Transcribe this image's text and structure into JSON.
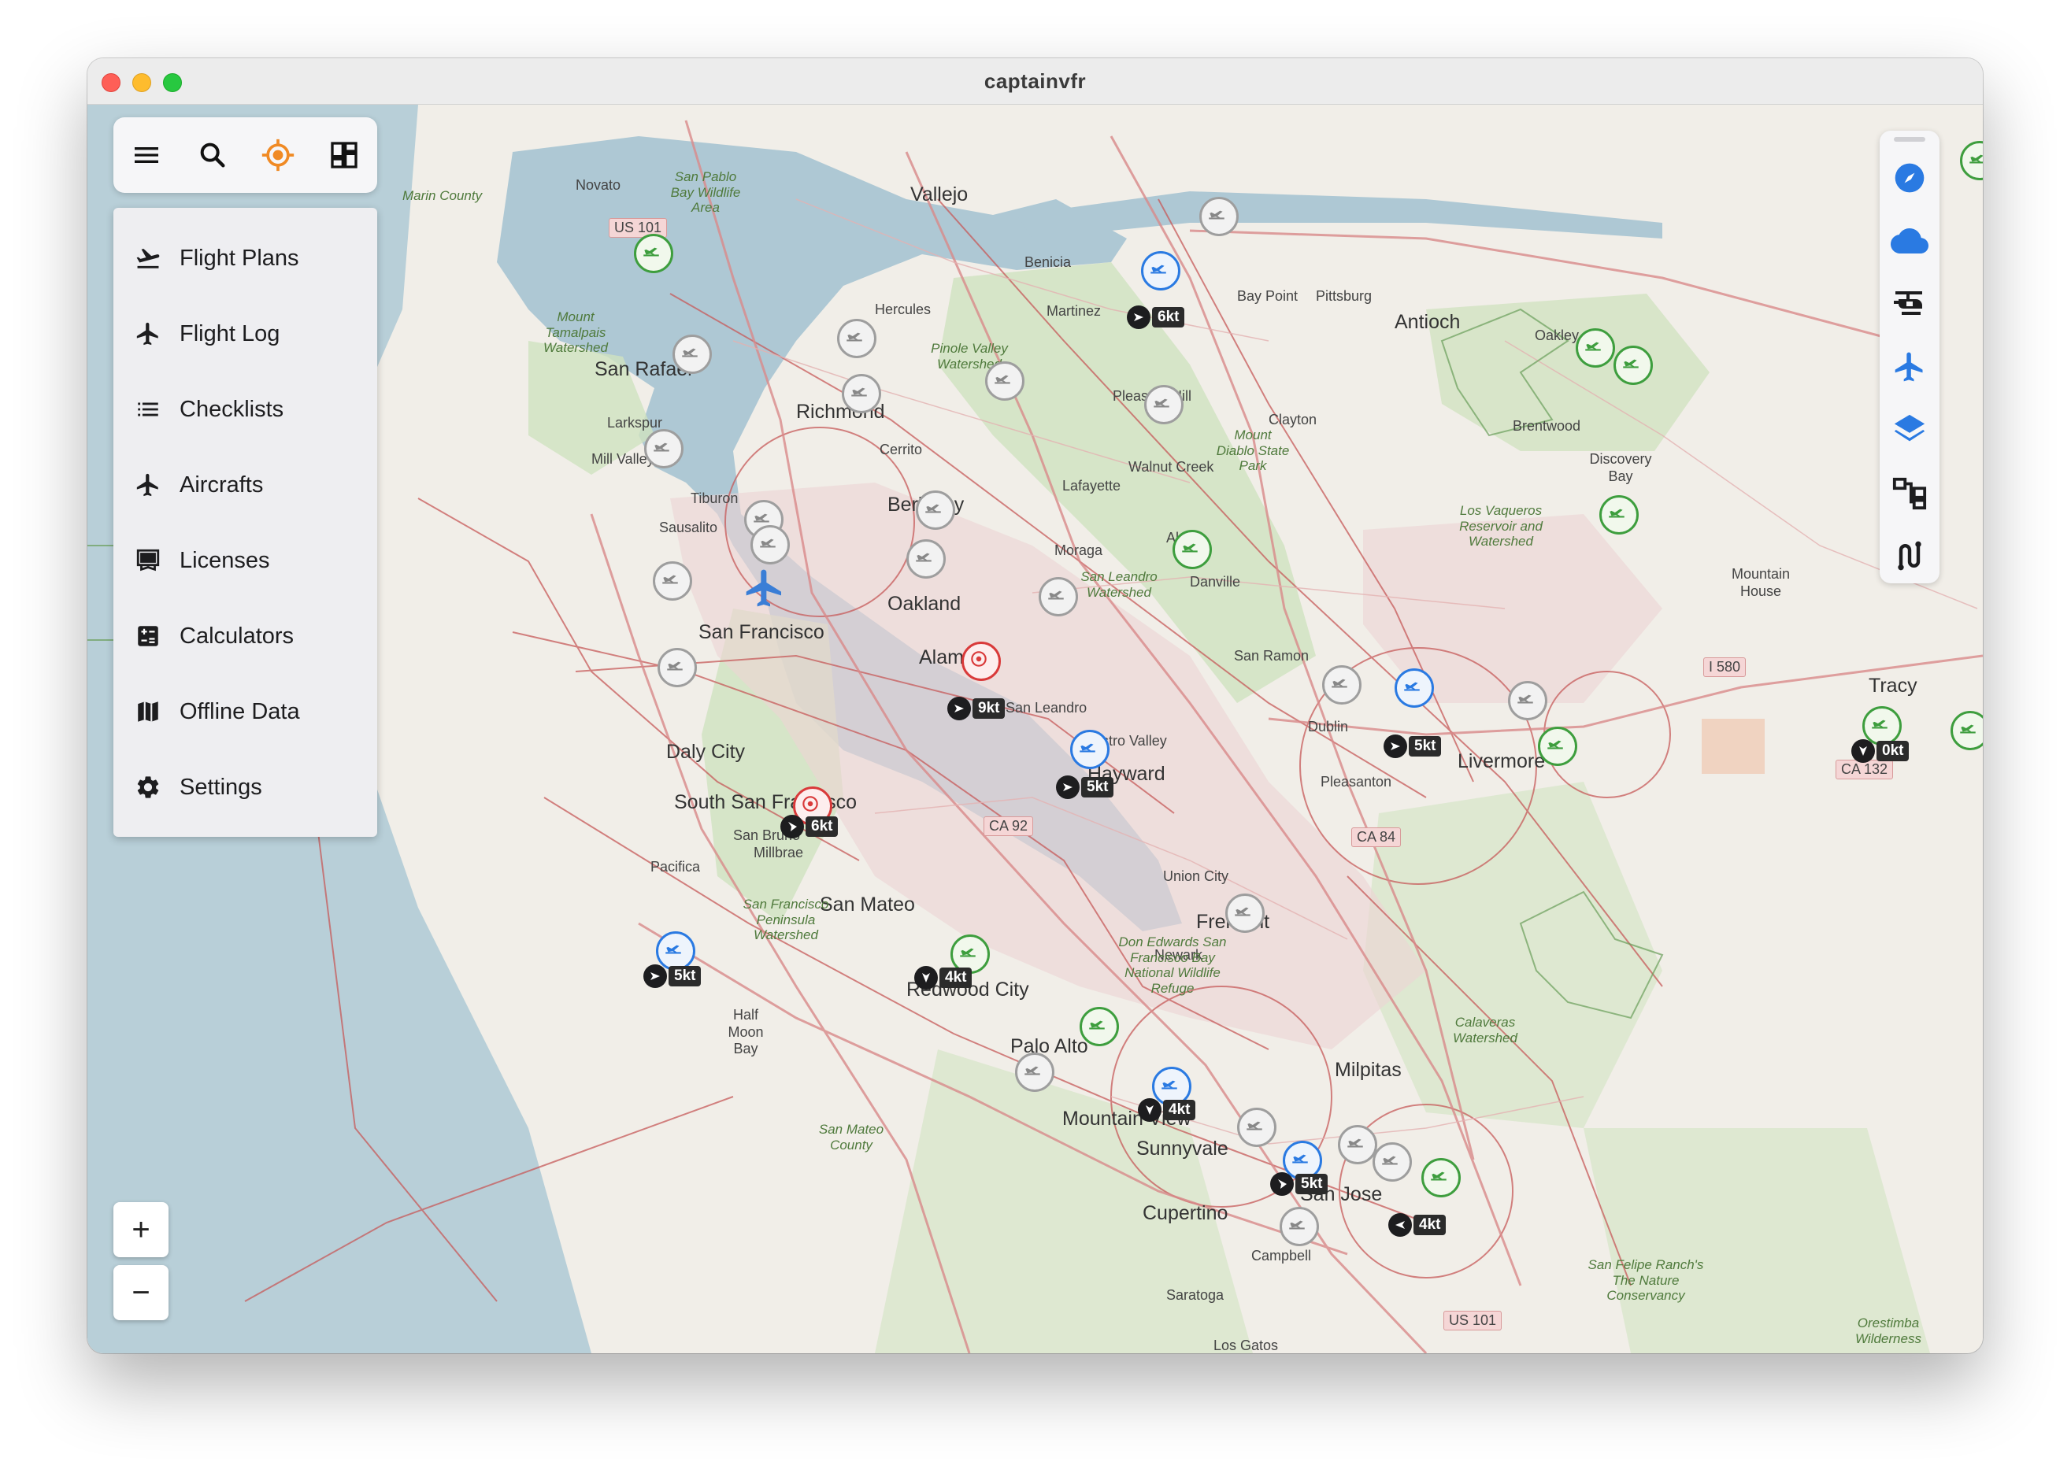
{
  "window": {
    "title": "captainvfr"
  },
  "toolbar": {
    "buttons": [
      {
        "name": "menu-button",
        "icon": "hamburger-icon"
      },
      {
        "name": "search-button",
        "icon": "search-icon"
      },
      {
        "name": "location-button",
        "icon": "crosshair-location-icon"
      },
      {
        "name": "dashboard-button",
        "icon": "dashboard-icon"
      }
    ]
  },
  "menu": {
    "items": [
      {
        "label": "Flight Plans",
        "icon": "flight-takeoff-icon"
      },
      {
        "label": "Flight Log",
        "icon": "airplane-icon"
      },
      {
        "label": "Checklists",
        "icon": "list-icon"
      },
      {
        "label": "Aircrafts",
        "icon": "airplane-icon"
      },
      {
        "label": "Licenses",
        "icon": "license-card-icon"
      },
      {
        "label": "Calculators",
        "icon": "calculator-icon"
      },
      {
        "label": "Offline Data",
        "icon": "map-icon"
      },
      {
        "label": "Settings",
        "icon": "gear-icon"
      }
    ]
  },
  "zoom": {
    "in_label": "+",
    "out_label": "−"
  },
  "right_toolbar": {
    "buttons": [
      {
        "name": "navaids-toggle",
        "icon": "compass-icon",
        "color": "#2a7ae2"
      },
      {
        "name": "weather-toggle",
        "icon": "cloud-icon",
        "color": "#2a7ae2"
      },
      {
        "name": "heliports-toggle",
        "icon": "helicopter-icon",
        "color": "#1d1d1f"
      },
      {
        "name": "airports-toggle",
        "icon": "airplane-icon",
        "color": "#2a7ae2"
      },
      {
        "name": "airspaces-toggle",
        "icon": "layers-icon",
        "color": "#2a7ae2"
      },
      {
        "name": "reporting-points-toggle",
        "icon": "hierarchy-icon",
        "color": "#1d1d1f"
      },
      {
        "name": "route-toggle",
        "icon": "route-icon",
        "color": "#1d1d1f"
      }
    ]
  },
  "map": {
    "places": [
      {
        "text": "Vallejo",
        "kind": "city"
      },
      {
        "text": "Novato",
        "kind": "small"
      },
      {
        "text": "Benicia",
        "kind": "small"
      },
      {
        "text": "Martinez",
        "kind": "small"
      },
      {
        "text": "Hercules",
        "kind": "small"
      },
      {
        "text": "Bay Point",
        "kind": "small"
      },
      {
        "text": "Pittsburg",
        "kind": "small"
      },
      {
        "text": "Antioch",
        "kind": "city"
      },
      {
        "text": "Oakley",
        "kind": "small"
      },
      {
        "text": "Brentwood",
        "kind": "small"
      },
      {
        "text": "Discovery Bay",
        "kind": "small"
      },
      {
        "text": "San Rafael",
        "kind": "city"
      },
      {
        "text": "Larkspur",
        "kind": "small"
      },
      {
        "text": "Mill Valley",
        "kind": "small"
      },
      {
        "text": "Tiburon",
        "kind": "small"
      },
      {
        "text": "Sausalito",
        "kind": "small"
      },
      {
        "text": "Richmond",
        "kind": "city"
      },
      {
        "text": "Cerrito",
        "kind": "small"
      },
      {
        "text": "Pleasant Hill",
        "kind": "small"
      },
      {
        "text": "Walnut Creek",
        "kind": "small"
      },
      {
        "text": "Clayton",
        "kind": "small"
      },
      {
        "text": "Lafayette",
        "kind": "small"
      },
      {
        "text": "Berkeley",
        "kind": "city"
      },
      {
        "text": "Moraga",
        "kind": "small"
      },
      {
        "text": "Alamo",
        "kind": "small"
      },
      {
        "text": "Danville",
        "kind": "small"
      },
      {
        "text": "San Francisco",
        "kind": "city"
      },
      {
        "text": "Oakland",
        "kind": "city"
      },
      {
        "text": "Alameda",
        "kind": "city"
      },
      {
        "text": "San Leandro",
        "kind": "small"
      },
      {
        "text": "San Ramon",
        "kind": "small"
      },
      {
        "text": "Castro Valley",
        "kind": "small"
      },
      {
        "text": "Hayward",
        "kind": "city"
      },
      {
        "text": "Dublin",
        "kind": "small"
      },
      {
        "text": "Pleasanton",
        "kind": "small"
      },
      {
        "text": "Livermore",
        "kind": "city"
      },
      {
        "text": "Tracy",
        "kind": "city"
      },
      {
        "text": "Mountain House",
        "kind": "small"
      },
      {
        "text": "Daly City",
        "kind": "city"
      },
      {
        "text": "South San Francisco",
        "kind": "city"
      },
      {
        "text": "San Bruno",
        "kind": "small"
      },
      {
        "text": "Millbrae",
        "kind": "small"
      },
      {
        "text": "Pacifica",
        "kind": "small"
      },
      {
        "text": "San Mateo",
        "kind": "city"
      },
      {
        "text": "Union City",
        "kind": "small"
      },
      {
        "text": "Fremont",
        "kind": "city"
      },
      {
        "text": "Newark",
        "kind": "small"
      },
      {
        "text": "Half Moon Bay",
        "kind": "small"
      },
      {
        "text": "Redwood City",
        "kind": "city"
      },
      {
        "text": "Palo Alto",
        "kind": "city"
      },
      {
        "text": "Milpitas",
        "kind": "city"
      },
      {
        "text": "Mountain View",
        "kind": "city"
      },
      {
        "text": "Sunnyvale",
        "kind": "city"
      },
      {
        "text": "San Jose",
        "kind": "city"
      },
      {
        "text": "Cupertino",
        "kind": "city"
      },
      {
        "text": "Campbell",
        "kind": "small"
      },
      {
        "text": "Saratoga",
        "kind": "small"
      },
      {
        "text": "Los Gatos",
        "kind": "small"
      },
      {
        "text": "Marin County",
        "kind": "park"
      },
      {
        "text": "San Pablo Bay Wildlife Area",
        "kind": "park"
      },
      {
        "text": "Mount Tamalpais Watershed",
        "kind": "park"
      },
      {
        "text": "Pinole Valley Watershed",
        "kind": "park"
      },
      {
        "text": "Mount Diablo State Park",
        "kind": "park"
      },
      {
        "text": "Los Vaqueros Reservoir and Watershed",
        "kind": "park"
      },
      {
        "text": "San Leandro Watershed",
        "kind": "park"
      },
      {
        "text": "San Francisco Peninsula Watershed",
        "kind": "park"
      },
      {
        "text": "Don Edwards San Francisco Bay National Wildlife Refuge",
        "kind": "park"
      },
      {
        "text": "Calaveras Watershed",
        "kind": "park"
      },
      {
        "text": "San Mateo County",
        "kind": "park"
      },
      {
        "text": "San Felipe Ranch's The Nature Conservancy",
        "kind": "park"
      },
      {
        "text": "Orestimba Wilderness",
        "kind": "park"
      }
    ],
    "shields": [
      "US 101",
      "CA 92",
      "CA 84",
      "I 580",
      "CA 132",
      "US 101"
    ],
    "wind_readouts": [
      {
        "label": "6kt"
      },
      {
        "label": "9kt"
      },
      {
        "label": "5kt"
      },
      {
        "label": "5kt"
      },
      {
        "label": "0kt"
      },
      {
        "label": "6kt"
      },
      {
        "label": "5kt"
      },
      {
        "label": "4kt"
      },
      {
        "label": "4kt"
      },
      {
        "label": "5kt"
      },
      {
        "label": "4kt"
      }
    ]
  }
}
